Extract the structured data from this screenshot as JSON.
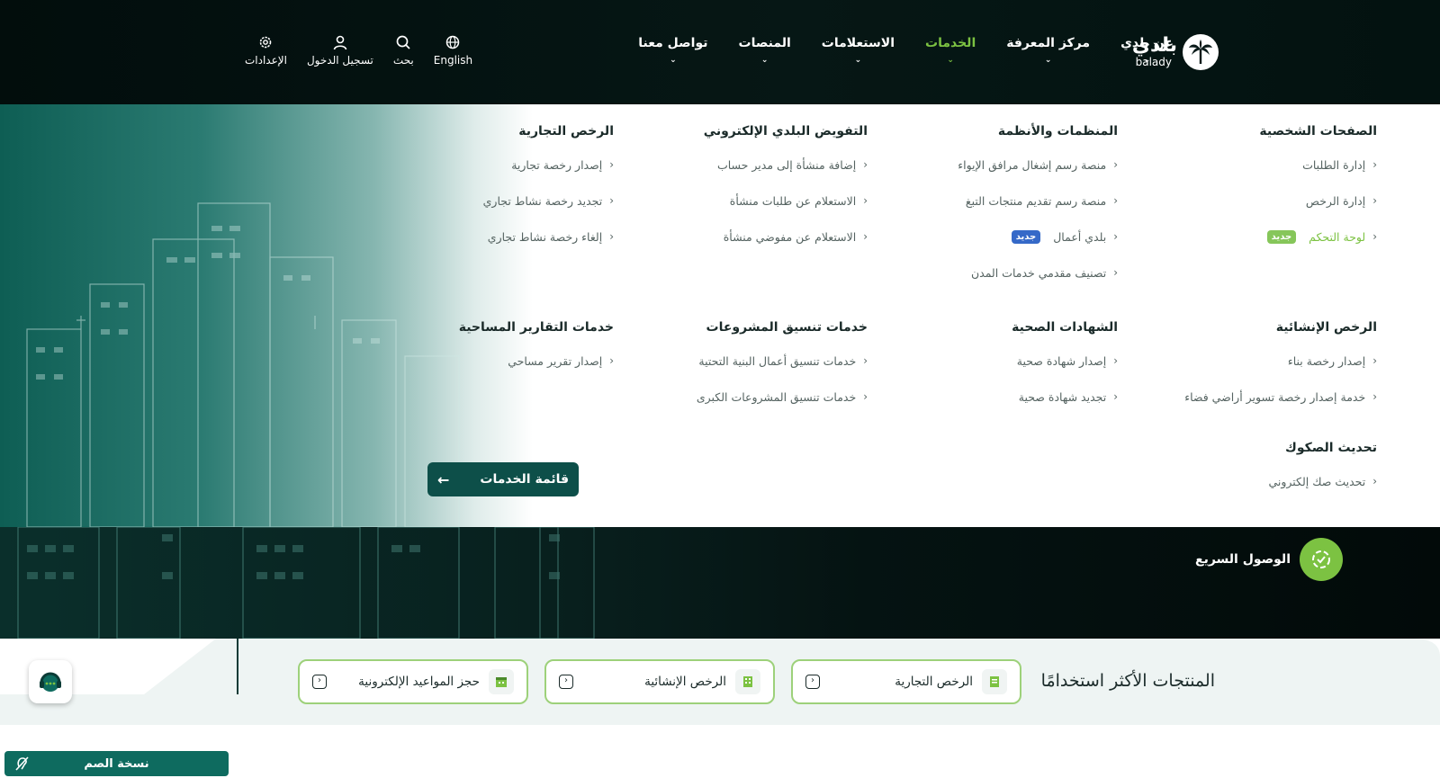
{
  "header": {
    "logo": {
      "text": "بلدي",
      "sub": "balady"
    },
    "nav": [
      {
        "label": "عن بلدي",
        "active": false
      },
      {
        "label": "مركز المعرفة",
        "active": false
      },
      {
        "label": "الخدمات",
        "active": true
      },
      {
        "label": "الاستعلامات",
        "active": false
      },
      {
        "label": "المنصات",
        "active": false
      },
      {
        "label": "تواصل معنا",
        "active": false
      }
    ],
    "utils": {
      "language": "English",
      "search": "بحث",
      "login": "تسجيل الدخول",
      "settings": "الإعدادات"
    }
  },
  "mega_menu": {
    "personal_pages": {
      "title": "الصفحات الشخصية",
      "links": [
        "إدارة الطلبات",
        "إدارة الرخص",
        "لوحة التحكم"
      ],
      "badge": "جديد"
    },
    "platforms": {
      "title": "المنظمات والأنظمة",
      "links": [
        "منصة رسم إشغال مرافق الإيواء",
        "منصة رسم تقديم منتجات التبغ",
        "بلدي أعمال",
        "تصنيف مقدمي خدمات المدن"
      ],
      "badge": "جديد"
    },
    "delegation": {
      "title": "التفويض البلدي الإلكتروني",
      "links": [
        "إضافة منشأة إلى مدير حساب",
        "الاستعلام عن طلبات منشأة",
        "الاستعلام عن مفوضي منشأة"
      ]
    },
    "commercial": {
      "title": "الرخص التجارية",
      "links": [
        "إصدار رخصة تجارية",
        "تجديد رخصة نشاط تجاري",
        "إلغاء رخصة نشاط تجاري"
      ]
    },
    "construction": {
      "title": "الرخص الإنشائية",
      "links": [
        "إصدار رخصة بناء",
        "خدمة إصدار رخصة تسوير أراضي فضاء"
      ]
    },
    "health": {
      "title": "الشهادات الصحية",
      "links": [
        "إصدار شهادة صحية",
        "تجديد شهادة صحية"
      ]
    },
    "coordination": {
      "title": "خدمات تنسيق المشروعات",
      "links": [
        "خدمات تنسيق أعمال البنية التحتية",
        "خدمات تنسيق المشروعات الكبرى"
      ]
    },
    "survey": {
      "title": "خدمات التقارير المساحية",
      "links": [
        "إصدار تقرير مساحي"
      ]
    },
    "deeds": {
      "title": "تحديث الصكوك",
      "links": [
        "تحديث صك إلكتروني"
      ]
    },
    "services_button": "قائمة الخدمات"
  },
  "quick_access": {
    "label": "الوصول السريع"
  },
  "products": {
    "title": "المنتجات الأكثر استخدامًا",
    "items": [
      {
        "label": "الرخص التجارية"
      },
      {
        "label": "الرخص الإنشائية"
      },
      {
        "label": "حجز المواعيد الإلكترونية"
      }
    ]
  },
  "accessibility": {
    "deaf_version": "نسخة الصم"
  },
  "colors": {
    "accent_green": "#7cc242",
    "dark_teal": "#0d4f49",
    "badge_blue": "#3569c8"
  }
}
